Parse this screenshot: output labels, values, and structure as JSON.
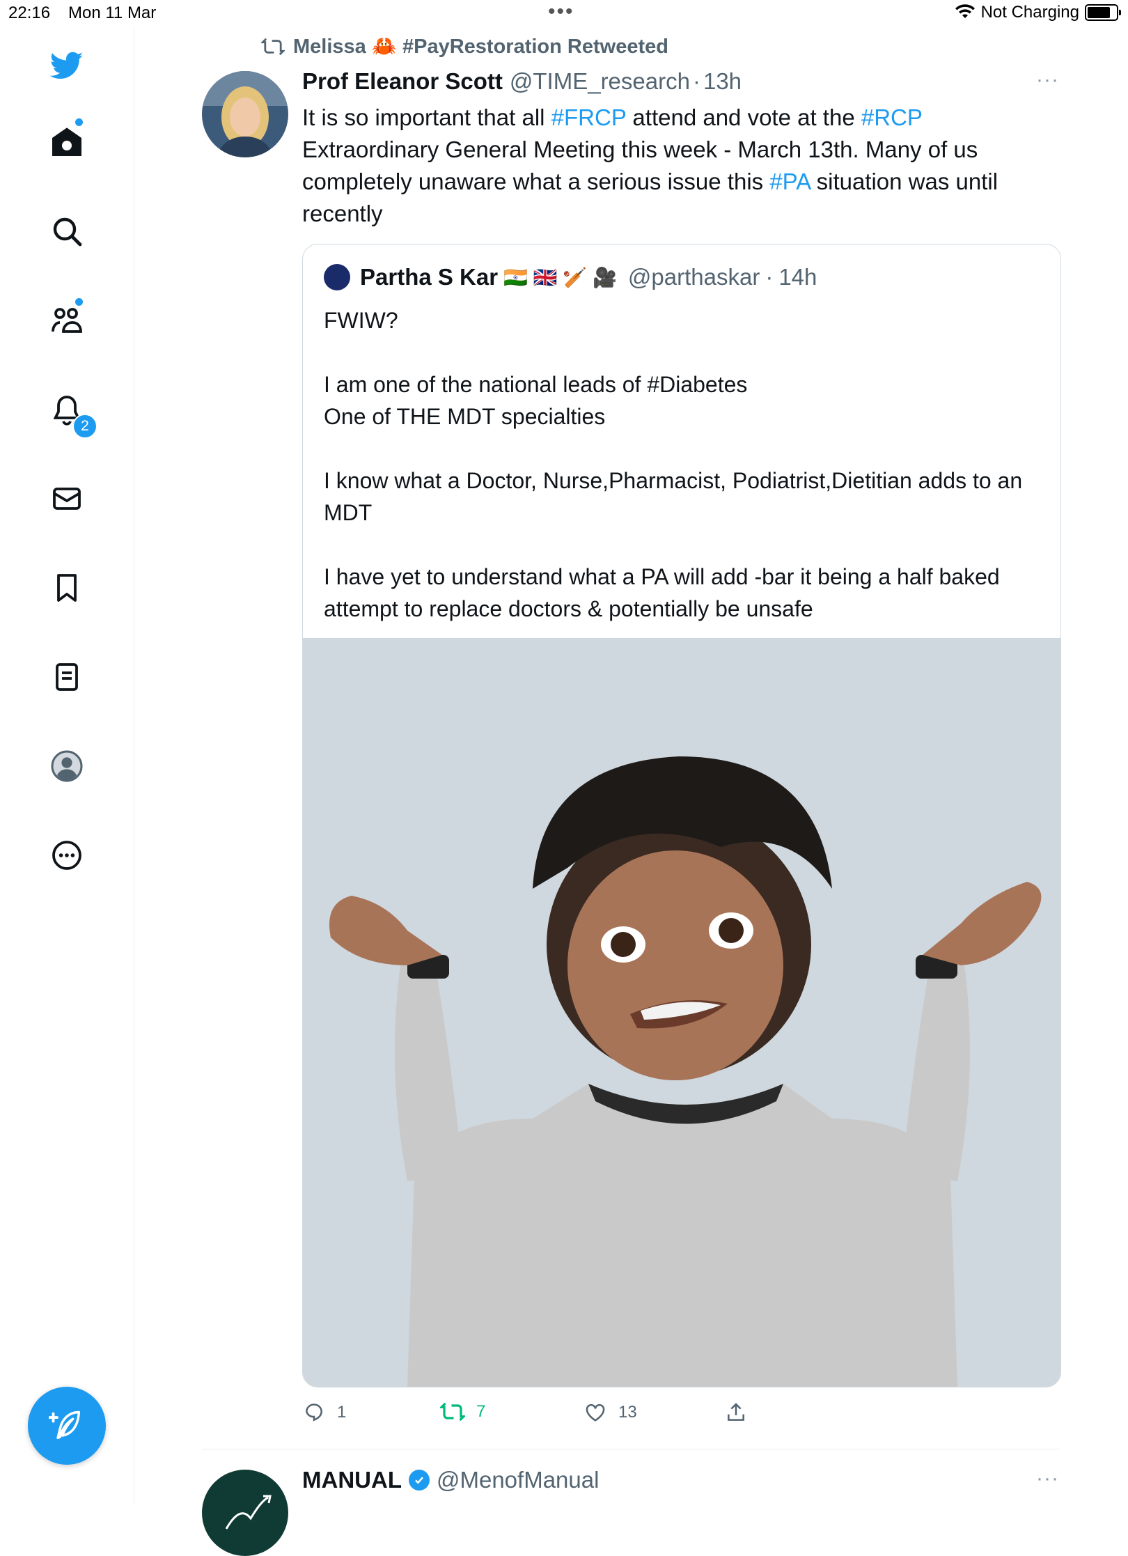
{
  "status_bar": {
    "time": "22:16",
    "date": "Mon 11 Mar",
    "charging": "Not Charging",
    "battery_level": 0.9
  },
  "sidebar": {
    "items": [
      {
        "name": "twitter-logo"
      },
      {
        "name": "home",
        "has_dot": true
      },
      {
        "name": "search"
      },
      {
        "name": "communities",
        "has_dot": true
      },
      {
        "name": "notifications",
        "badge": "2"
      },
      {
        "name": "messages"
      },
      {
        "name": "bookmarks"
      },
      {
        "name": "lists"
      },
      {
        "name": "profile"
      },
      {
        "name": "more"
      }
    ],
    "compose_icon": "compose-feather-icon"
  },
  "tweet": {
    "retweeted_by": "Melissa 🦀 #PayRestoration Retweeted",
    "author_name": "Prof Eleanor Scott",
    "author_handle": "@TIME_research",
    "time": "13h",
    "more": "···",
    "text_parts": [
      {
        "t": "It is so important that all ",
        "tag": false
      },
      {
        "t": "#FRCP",
        "tag": true
      },
      {
        "t": " attend and vote at the ",
        "tag": false
      },
      {
        "t": "#RCP",
        "tag": true
      },
      {
        "t": " Extraordinary General Meeting this week - March 13th. Many of us completely unaware what a serious issue this ",
        "tag": false
      },
      {
        "t": "#PA",
        "tag": true
      },
      {
        "t": " situation was until recently",
        "tag": false
      }
    ],
    "quote": {
      "author_name": "Partha S Kar",
      "author_emojis": "🇮🇳 🇬🇧 🏏 🎥",
      "author_handle": "@parthaskar",
      "time": "14h",
      "text": "FWIW?\n\nI am one of the national leads of #Diabetes\nOne of THE MDT specialties\n\nI know what a Doctor, Nurse,Pharmacist, Podiatrist,Dietitian adds to an MDT\n\nI have yet to understand what a PA will add -bar it being a half baked attempt to replace doctors & potentially be unsafe",
      "media": "shrugging-memoji-illustration"
    },
    "actions": {
      "replies": "1",
      "retweets": "7",
      "likes": "13"
    }
  },
  "next_tweet": {
    "author_name": "MANUAL",
    "author_handle": "@MenofManual",
    "more": "···"
  },
  "colors": {
    "accent": "#1d9bf0",
    "retweet_green": "#00ba7c",
    "secondary_text": "#536471",
    "border": "#cfd9de"
  }
}
